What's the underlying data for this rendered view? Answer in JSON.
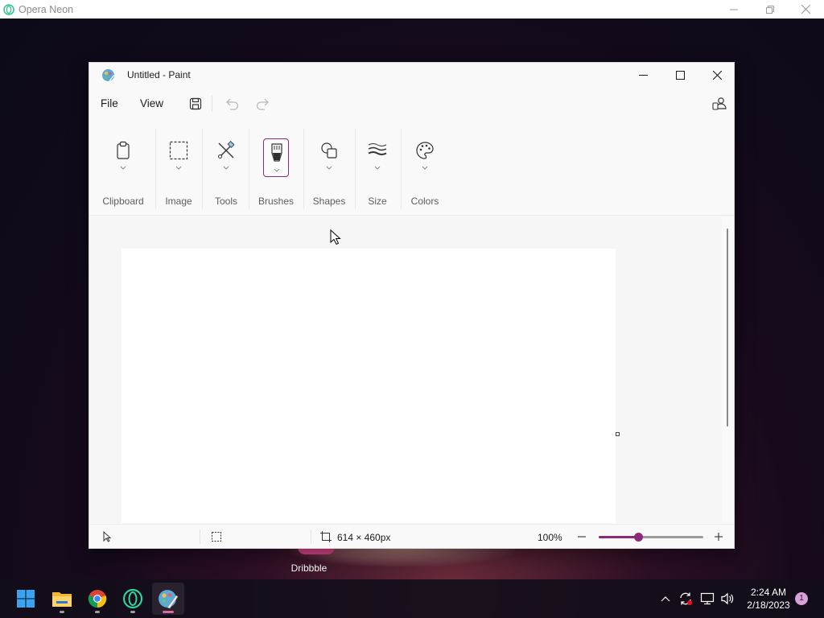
{
  "opera": {
    "title": "Opera Neon"
  },
  "desktop": {
    "label": "Dribbble"
  },
  "paint": {
    "title": "Untitled - Paint",
    "menu": {
      "file": "File",
      "view": "View"
    },
    "ribbon": [
      {
        "label": "Clipboard",
        "icon": "clipboard-icon"
      },
      {
        "label": "Image",
        "icon": "selection-icon"
      },
      {
        "label": "Tools",
        "icon": "tools-icon"
      },
      {
        "label": "Brushes",
        "icon": "brush-icon",
        "selected": true
      },
      {
        "label": "Shapes",
        "icon": "shapes-icon"
      },
      {
        "label": "Size",
        "icon": "size-icon"
      },
      {
        "label": "Colors",
        "icon": "palette-icon"
      }
    ],
    "status": {
      "canvas_size": "614 × 460px",
      "zoom_text": "100%",
      "zoom_level_fraction": 0.38
    },
    "accent": "#8b2a78"
  },
  "taskbar": {
    "apps": [
      "start-icon",
      "file-explorer-icon",
      "chrome-icon",
      "opera-neon-icon",
      "paint-icon"
    ],
    "time": "2:24 AM",
    "date": "2/18/2023",
    "notifications": "1"
  }
}
